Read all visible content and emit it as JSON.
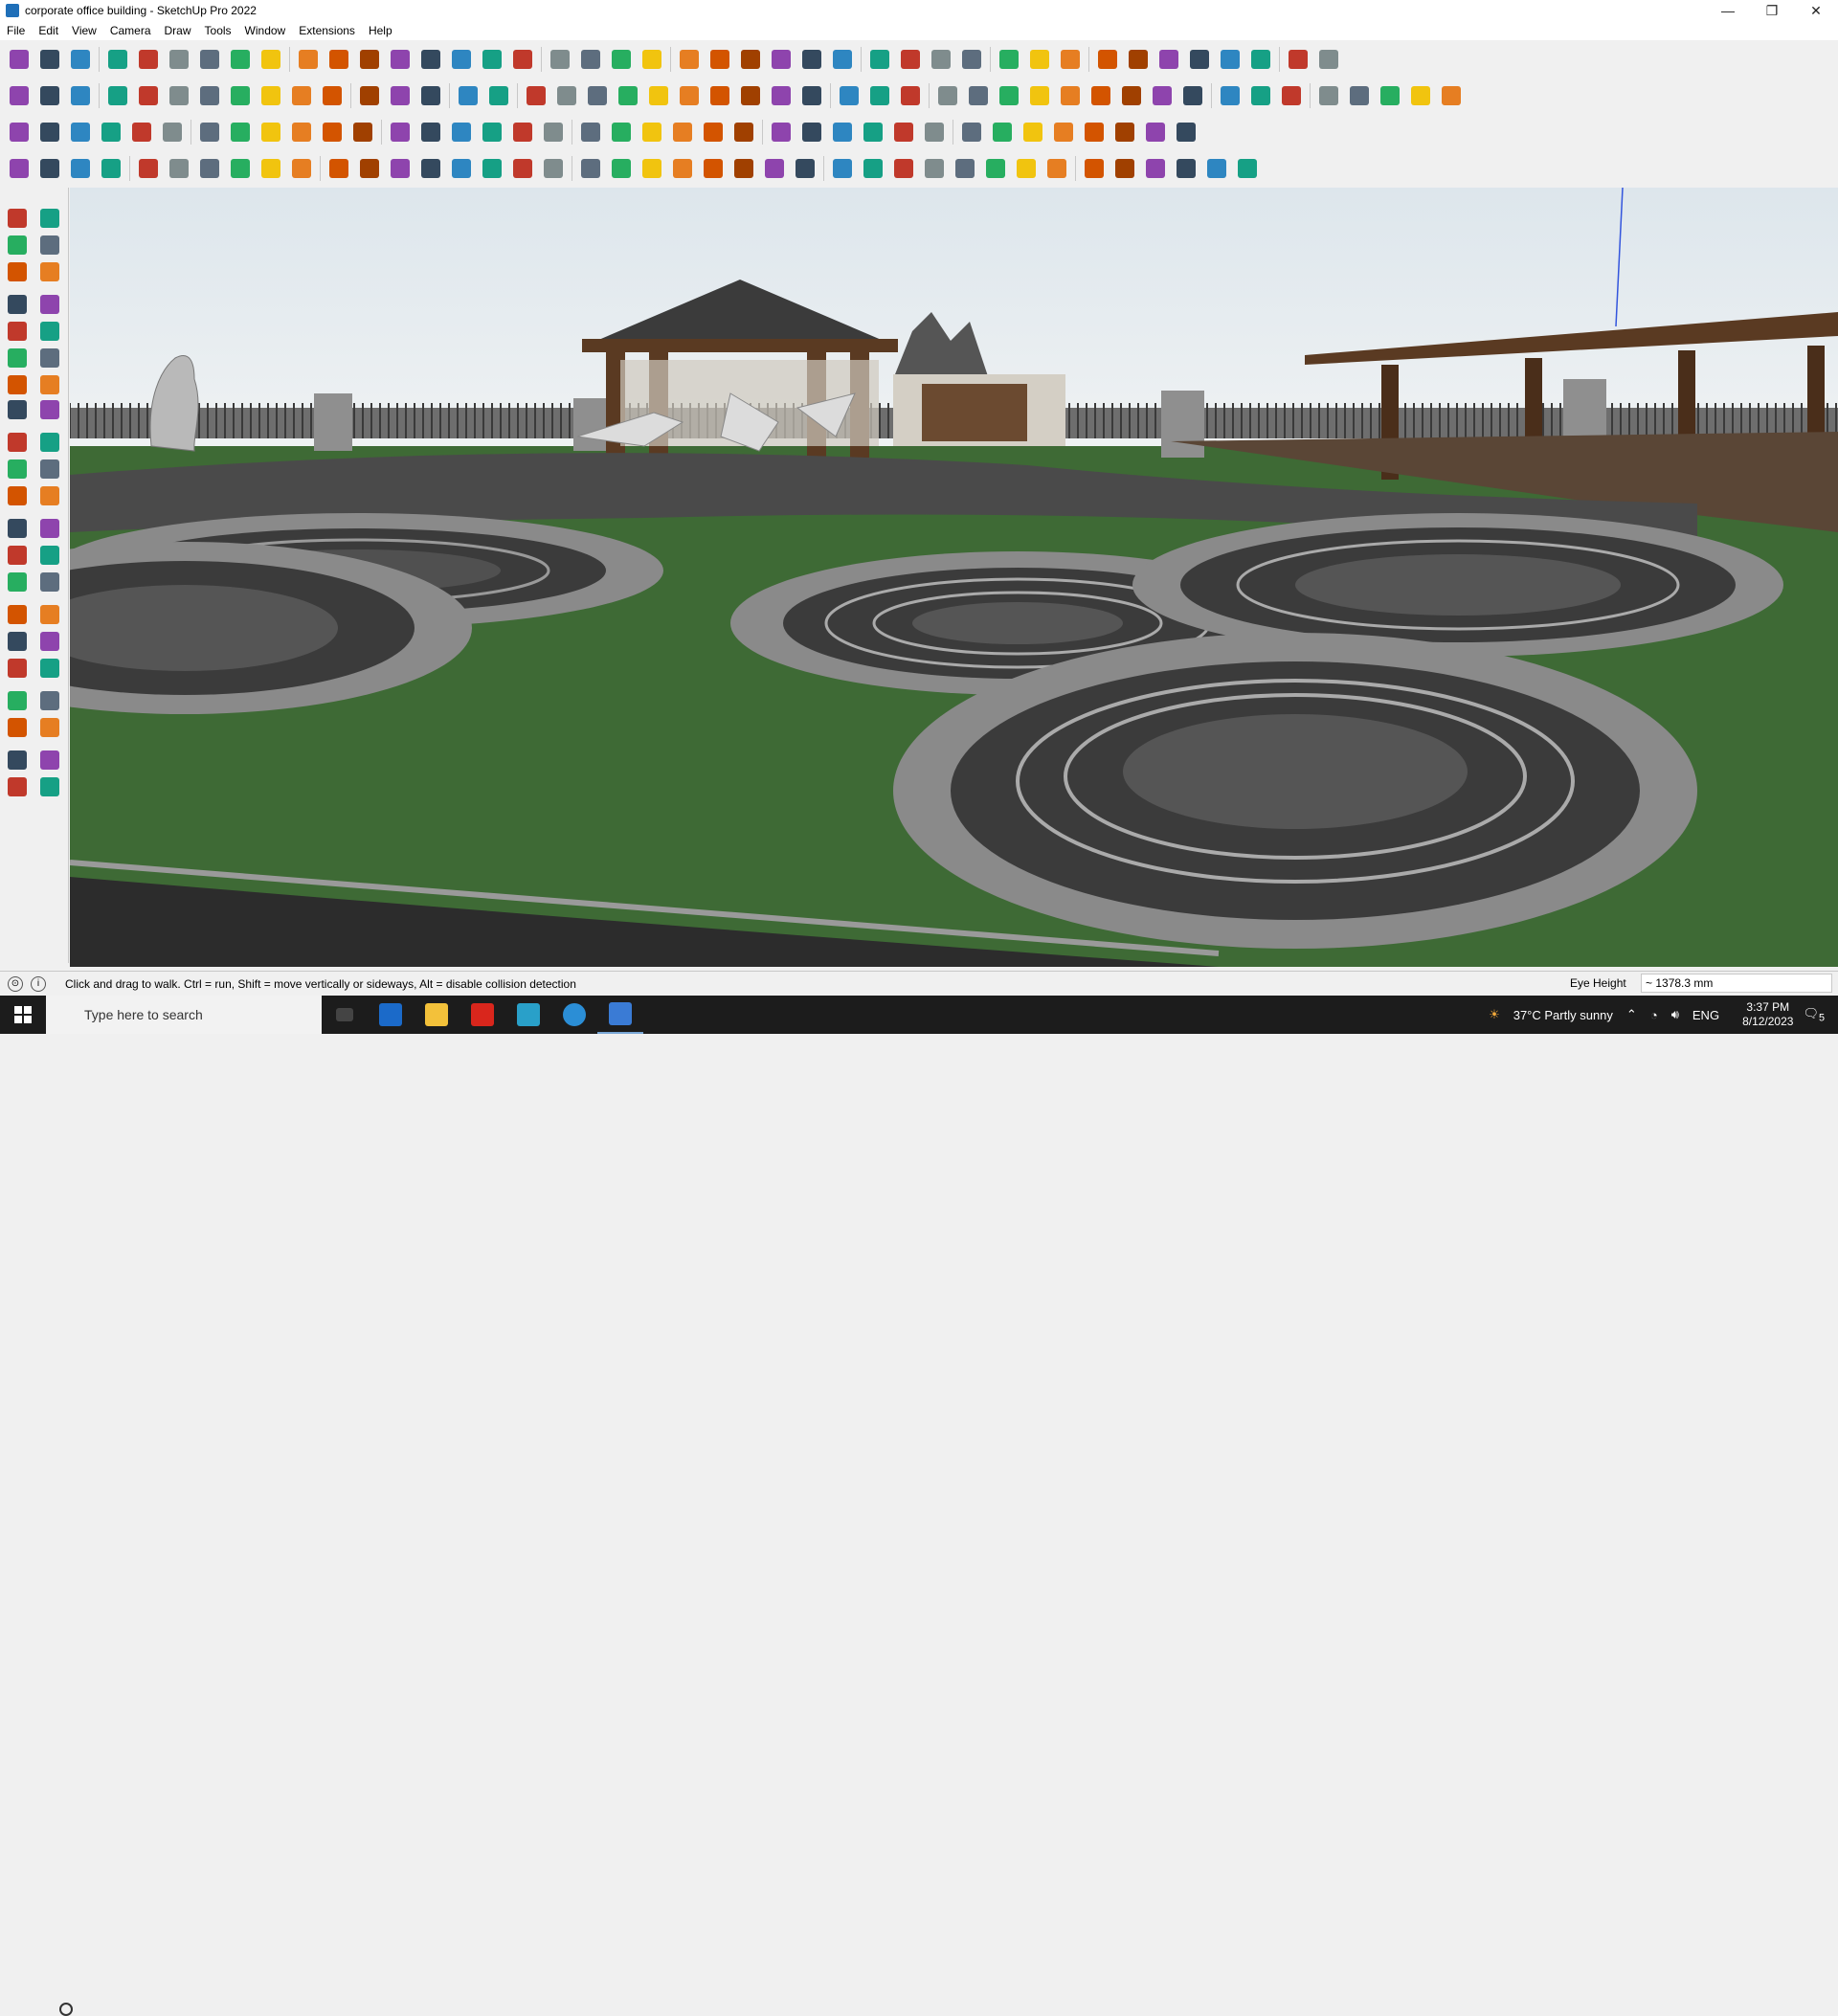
{
  "window": {
    "title": "corporate office building - SketchUp Pro 2022",
    "minimize": "—",
    "maximize": "❐",
    "close": "✕"
  },
  "menu": [
    "File",
    "Edit",
    "View",
    "Camera",
    "Draw",
    "Tools",
    "Window",
    "Extensions",
    "Help"
  ],
  "status": {
    "message": "Click and drag to walk.  Ctrl = run, Shift = move vertically or sideways, Alt = disable collision detection",
    "measure_label": "Eye Height",
    "measure_value": "~ 1378.3 mm"
  },
  "taskbar": {
    "search_placeholder": "Type here to search",
    "weather": "37°C  Partly sunny",
    "language": "ENG",
    "time": "3:37 PM",
    "date": "8/12/2023",
    "notification_count": "5"
  },
  "colors": {
    "accent": "#1f6fb8",
    "grass": "#3e6a35",
    "paving": "#8a8a8a",
    "wood": "#5a3a22"
  }
}
